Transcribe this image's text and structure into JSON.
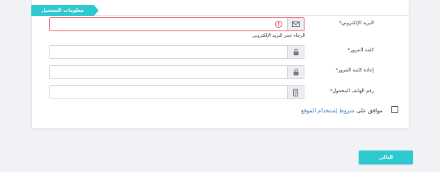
{
  "form": {
    "section_title": "معلومات التسجيل",
    "email": {
      "label": "البريد الإلكتروني*",
      "value": "",
      "error": "الرجاء حجز البريد الإلكتروني",
      "icon": "envelope-icon"
    },
    "password": {
      "label": "كلمة المرور*",
      "value": "",
      "icon": "lock-icon"
    },
    "confirm_password": {
      "label": "إعادة كلمة المرور*",
      "value": "",
      "icon": "lock-icon"
    },
    "mobile": {
      "label": "رقم الهاتف المحمول*",
      "value": "",
      "icon": "mobile-icon"
    },
    "terms": {
      "prefix": "موافق على",
      "link": "شروط إستخدام الموقع",
      "checked": false
    },
    "next_label": "التالي"
  },
  "colors": {
    "accent": "#2ec8d0",
    "error": "#e04b57",
    "link": "#1a73c7"
  }
}
